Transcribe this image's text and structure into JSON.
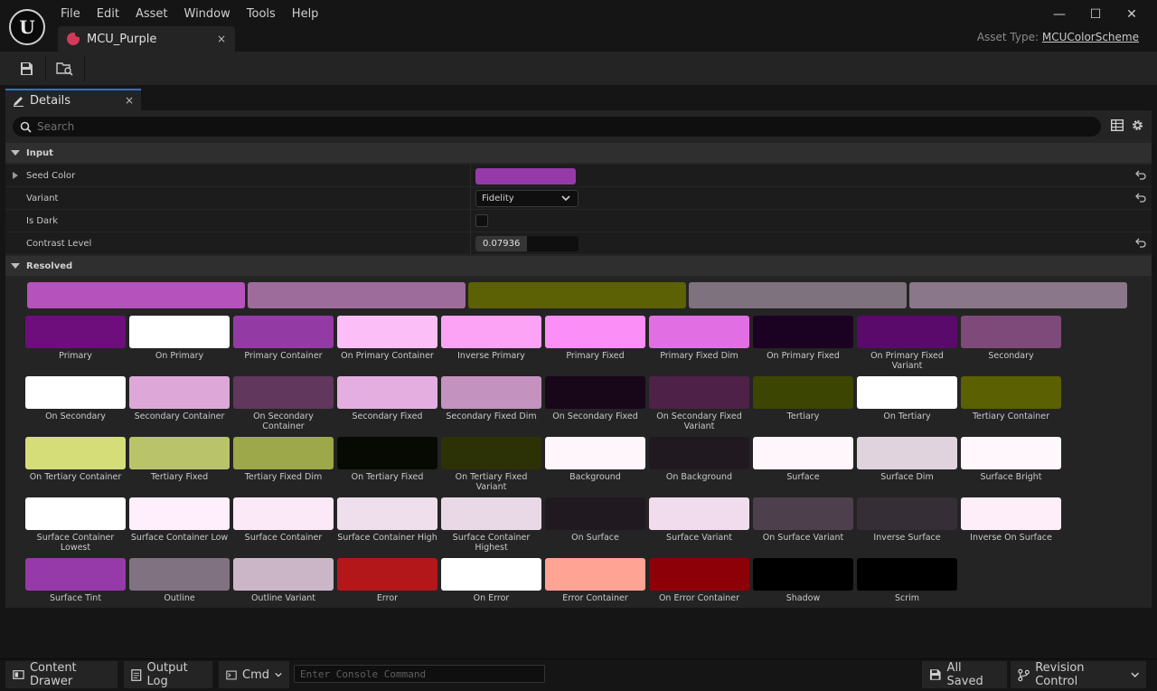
{
  "menu": [
    "File",
    "Edit",
    "Asset",
    "Window",
    "Tools",
    "Help"
  ],
  "logo_text": "U",
  "document_tab": {
    "label": "MCU_Purple",
    "close": "×"
  },
  "asset_type": {
    "label": "Asset Type:",
    "value": "MCUColorScheme"
  },
  "window_controls": {
    "minimize": "—",
    "maximize": "☐",
    "close": "✕"
  },
  "details_tab": {
    "label": "Details",
    "close": "×"
  },
  "search": {
    "placeholder": "Search"
  },
  "sections": {
    "input": "Input",
    "resolved": "Resolved"
  },
  "properties": {
    "seed_color": {
      "label": "Seed Color",
      "color": "#953aa8"
    },
    "variant": {
      "label": "Variant",
      "value": "Fidelity"
    },
    "is_dark": {
      "label": "Is Dark",
      "checked": false
    },
    "contrast_level": {
      "label": "Contrast Level",
      "value": "0.07936",
      "fill_fraction": 0.5
    }
  },
  "palette_bar": [
    "#b552bb",
    "#9d6c9b",
    "#5b6104",
    "#7d727d",
    "#8a7789"
  ],
  "roles": [
    {
      "label": "Primary",
      "color": "#6e0e7d"
    },
    {
      "label": "On Primary",
      "color": "#ffffff"
    },
    {
      "label": "Primary Container",
      "color": "#943aa4"
    },
    {
      "label": "On Primary Container",
      "color": "#fbbef7"
    },
    {
      "label": "Inverse Primary",
      "color": "#fca3f6"
    },
    {
      "label": "Primary Fixed",
      "color": "#fb8ef7"
    },
    {
      "label": "Primary Fixed Dim",
      "color": "#e16fe3"
    },
    {
      "label": "On Primary Fixed",
      "color": "#1c0222"
    },
    {
      "label": "On Primary Fixed Variant",
      "color": "#5a0a6a"
    },
    {
      "label": "Secondary",
      "color": "#7d4a79"
    },
    {
      "label": "On Secondary",
      "color": "#ffffff"
    },
    {
      "label": "Secondary Container",
      "color": "#dda8d8"
    },
    {
      "label": "On Secondary Container",
      "color": "#61375e"
    },
    {
      "label": "Secondary Fixed",
      "color": "#e4aee0"
    },
    {
      "label": "Secondary Fixed Dim",
      "color": "#c492bf"
    },
    {
      "label": "On Secondary Fixed",
      "color": "#170719"
    },
    {
      "label": "On Secondary Fixed Variant",
      "color": "#4e2248"
    },
    {
      "label": "Tertiary",
      "color": "#3d4502"
    },
    {
      "label": "On Tertiary",
      "color": "#ffffff"
    },
    {
      "label": "Tertiary Container",
      "color": "#5b6002"
    },
    {
      "label": "On Tertiary Container",
      "color": "#d5dd79"
    },
    {
      "label": "Tertiary Fixed",
      "color": "#b9c46a"
    },
    {
      "label": "Tertiary Fixed Dim",
      "color": "#9ca84a"
    },
    {
      "label": "On Tertiary Fixed",
      "color": "#070a02"
    },
    {
      "label": "On Tertiary Fixed Variant",
      "color": "#2d3206"
    },
    {
      "label": "Background",
      "color": "#fff6fb"
    },
    {
      "label": "On Background",
      "color": "#201a20"
    },
    {
      "label": "Surface",
      "color": "#fff6fb"
    },
    {
      "label": "Surface Dim",
      "color": "#e0d3de"
    },
    {
      "label": "Surface Bright",
      "color": "#fff7fc"
    },
    {
      "label": "Surface Container Lowest",
      "color": "#ffffff"
    },
    {
      "label": "Surface Container Low",
      "color": "#ffeefb"
    },
    {
      "label": "Surface Container",
      "color": "#fbe9f7"
    },
    {
      "label": "Surface Container High",
      "color": "#efdeec"
    },
    {
      "label": "Surface Container Highest",
      "color": "#e9d9e6"
    },
    {
      "label": "On Surface",
      "color": "#201a20"
    },
    {
      "label": "Surface Variant",
      "color": "#f0dcec"
    },
    {
      "label": "On Surface Variant",
      "color": "#4e3f4d"
    },
    {
      "label": "Inverse Surface",
      "color": "#362e36"
    },
    {
      "label": "Inverse On Surface",
      "color": "#fdeefa"
    },
    {
      "label": "Surface Tint",
      "color": "#953aa8"
    },
    {
      "label": "Outline",
      "color": "#817281"
    },
    {
      "label": "Outline Variant",
      "color": "#cbb6c8"
    },
    {
      "label": "Error",
      "color": "#b3171a"
    },
    {
      "label": "On Error",
      "color": "#ffffff"
    },
    {
      "label": "Error Container",
      "color": "#ffa395"
    },
    {
      "label": "On Error Container",
      "color": "#8e0007"
    },
    {
      "label": "Shadow",
      "color": "#000000"
    },
    {
      "label": "Scrim",
      "color": "#000000"
    }
  ],
  "statusbar": {
    "content_drawer": "Content Drawer",
    "output_log": "Output Log",
    "cmd": "Cmd",
    "console_placeholder": "Enter Console Command",
    "all_saved": "All Saved",
    "revision_control": "Revision Control"
  }
}
